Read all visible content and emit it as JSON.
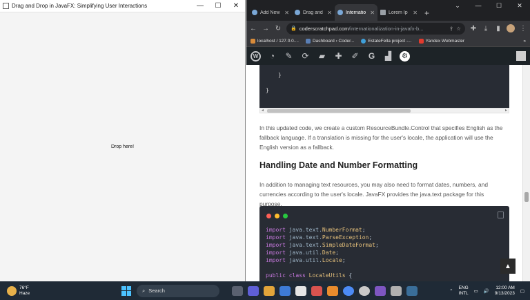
{
  "fx_window": {
    "title": "Drag and Drop in JavaFX: Simplifying User Interactions",
    "drop_label": "Drop here!",
    "controls": {
      "minimize": "—",
      "maximize": "☐",
      "close": "✕"
    }
  },
  "browser": {
    "tabs": [
      {
        "label": "Add New",
        "active": false
      },
      {
        "label": "Drag and",
        "active": false
      },
      {
        "label": "Internatio",
        "active": true
      },
      {
        "label": "Lorem Ip",
        "active": false
      }
    ],
    "new_tab": "+",
    "controls": {
      "dropdown": "⌄",
      "minimize": "—",
      "maximize": "☐",
      "close": "✕"
    },
    "address": {
      "domain": "coderscratchpad.com",
      "path": "/internationalization-in-javafx-b..."
    },
    "bookmarks": [
      {
        "label": "localhost / 127.0.0...."
      },
      {
        "label": "Dashboard ‹ Coder..."
      },
      {
        "label": "EstateFella project -..."
      },
      {
        "label": "Yandex Webmaster"
      }
    ],
    "bookmarks_more": "»"
  },
  "article": {
    "code_top_lines": [
      "}",
      "}"
    ],
    "paragraph_1": "In this updated code, we create a custom ResourceBundle.Control that specifies English as the fallback language. If a translation is missing for the user's locale, the application will use the English version as a fallback.",
    "heading": "Handling Date and Number Formatting",
    "paragraph_2": "In addition to managing text resources, you may also need to format dates, numbers, and currencies according to the user's locale. JavaFX provides the java.text package for this purpose.",
    "code_lines": [
      {
        "kw": "import",
        "pkg": "java.text.",
        "cls": "NumberFormat",
        "end": ";"
      },
      {
        "kw": "import",
        "pkg": "java.text.",
        "cls": "ParseException",
        "end": ";"
      },
      {
        "kw": "import",
        "pkg": "java.text.",
        "cls": "SimpleDateFormat",
        "end": ";"
      },
      {
        "kw": "import",
        "pkg": "java.util.",
        "cls": "Date",
        "end": ";"
      },
      {
        "kw": "import",
        "pkg": "java.util.",
        "cls": "Locale",
        "end": ";"
      }
    ],
    "code_class_line": {
      "kw": "public class",
      "cls": "LocaleUtils",
      "end": " {"
    },
    "to_top": "▲"
  },
  "taskbar": {
    "weather_temp": "76°F",
    "weather_desc": "Haze",
    "search_label": "Search",
    "lang_1": "ENG",
    "lang_2": "INTL",
    "time": "12:00 AM",
    "date": "9/13/2023"
  }
}
